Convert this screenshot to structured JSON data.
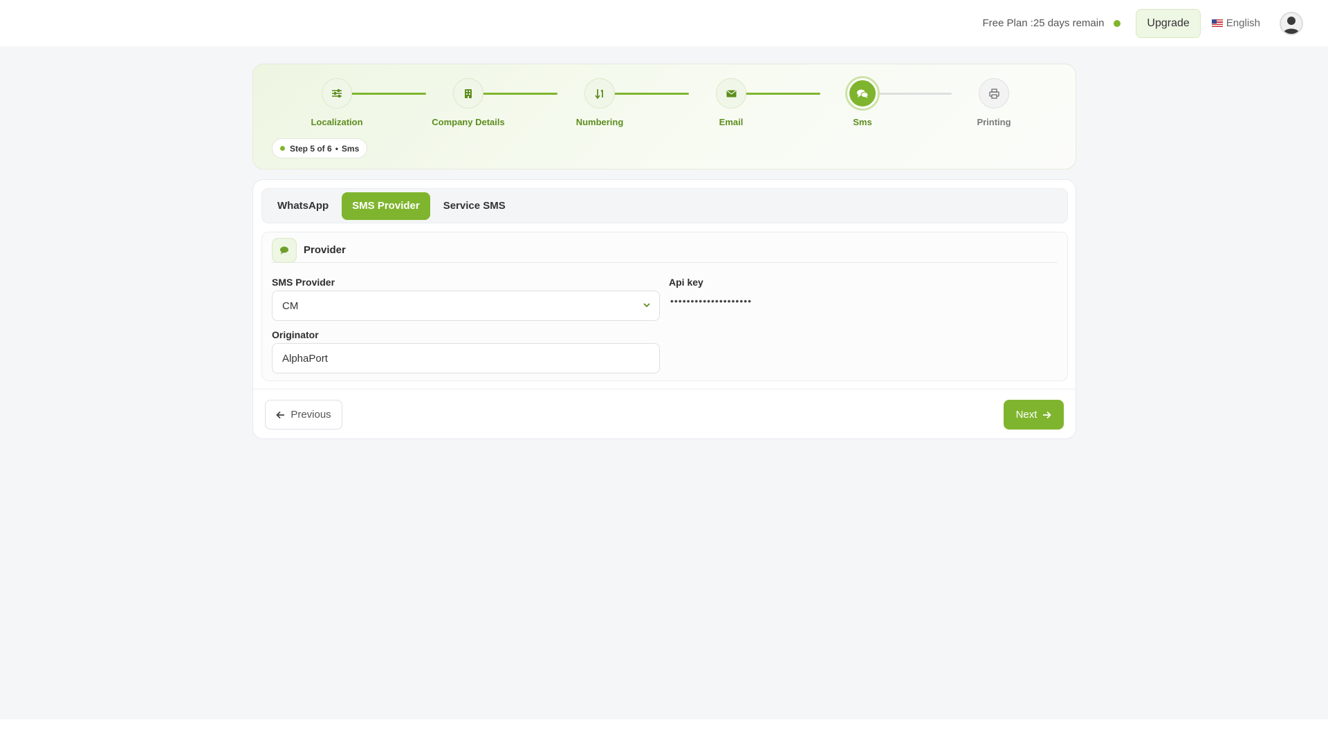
{
  "header": {
    "plan_text": "Free Plan :25 days remain",
    "upgrade_label": "Upgrade",
    "language_label": "English",
    "accent_color": "#7fb52e"
  },
  "stepper": {
    "steps": [
      {
        "label": "Localization",
        "icon": "sliders-icon",
        "status": "done"
      },
      {
        "label": "Company Details",
        "icon": "building-icon",
        "status": "done"
      },
      {
        "label": "Numbering",
        "icon": "sort-numbers-icon",
        "status": "done"
      },
      {
        "label": "Email",
        "icon": "envelope-icon",
        "status": "done"
      },
      {
        "label": "Sms",
        "icon": "chat-bubbles-icon",
        "status": "active"
      },
      {
        "label": "Printing",
        "icon": "printer-icon",
        "status": "todo"
      }
    ],
    "pill_step": "Step 5 of 6",
    "pill_sep": "•",
    "pill_name": "Sms"
  },
  "tabs": [
    {
      "label": "WhatsApp",
      "active": false
    },
    {
      "label": "SMS Provider",
      "active": true
    },
    {
      "label": "Service SMS",
      "active": false
    }
  ],
  "provider_section": {
    "title": "Provider",
    "icon": "chat-bubble-icon",
    "sms_provider_label": "SMS Provider",
    "sms_provider_value": "CM",
    "api_key_label": "Api key",
    "api_key_value": "••••••••••••••••••••",
    "originator_label": "Originator",
    "originator_value": "AlphaPort"
  },
  "footer": {
    "previous_label": "Previous",
    "next_label": "Next"
  }
}
